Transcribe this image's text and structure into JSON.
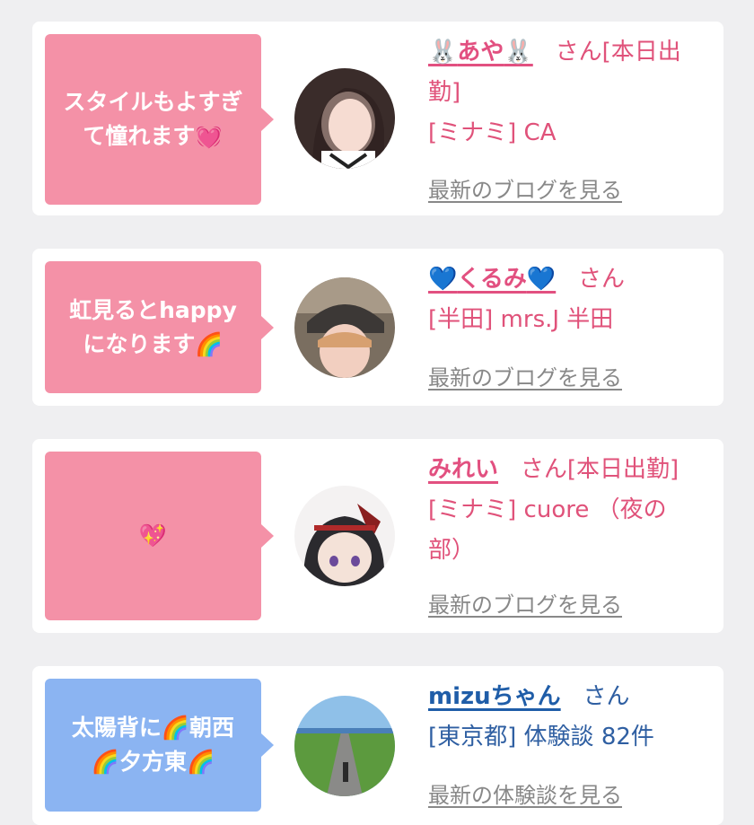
{
  "cards": [
    {
      "bubble_text": "スタイルもよすぎ\nて憧れます💓",
      "name_prefix_emoji": "🐰",
      "name": "あや",
      "name_suffix_emoji": "🐰",
      "honorific": "さん[本日出",
      "honorific_cont": "勤]",
      "shop_line": "[ミナミ] CA",
      "link_text": "最新のブログを見る"
    },
    {
      "bubble_text": "虹見るとhappy\nになります🌈",
      "name_prefix_emoji": "💙",
      "name": "くるみ",
      "name_suffix_emoji": "💙",
      "honorific": "さん",
      "shop_line": "[半田] mrs.J 半田",
      "link_text": "最新のブログを見る"
    },
    {
      "bubble_text": "💖",
      "name": "みれい",
      "honorific": "さん[本日出勤]",
      "shop_line": "[ミナミ] cuore （夜の",
      "shop_line_cont": "部）",
      "link_text": "最新のブログを見る"
    },
    {
      "bubble_text": "太陽背に🌈朝西\n🌈夕方東🌈",
      "name": "mizuちゃん",
      "honorific": "さん",
      "shop_line": "[東京都] 体験談 82件",
      "link_text": "最新の体験談を見る"
    }
  ],
  "colors": {
    "page_bg": "#efeff1",
    "card_bg": "#ffffff",
    "bubble_pink": "#f491a7",
    "bubble_blue": "#8bb4f2",
    "name_pink": "#e25080",
    "name_blue": "#1f5da8",
    "link_gray": "#888888"
  }
}
